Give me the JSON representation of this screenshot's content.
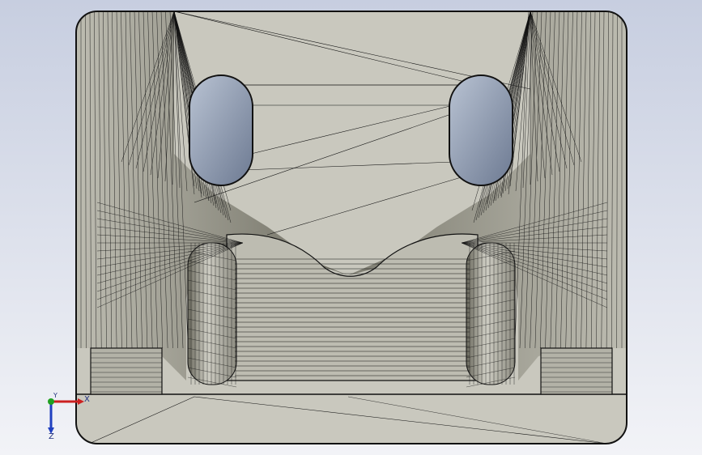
{
  "viewport": {
    "background_top": "#c7cee0",
    "background_bottom": "#f2f3f7"
  },
  "model": {
    "face_color": "#c9c8be",
    "shade_color": "#8d8c80",
    "dark_shade": "#6f6e62",
    "hole_color": "#8f9bb0",
    "edge_color": "#111111",
    "description_icon": "wireframe-part-mesh"
  },
  "triad": {
    "x_label": "X",
    "y_label": "Y",
    "z_label": "Z",
    "x_color": "#cc2020",
    "y_color": "#20a020",
    "z_color": "#2040c0"
  }
}
